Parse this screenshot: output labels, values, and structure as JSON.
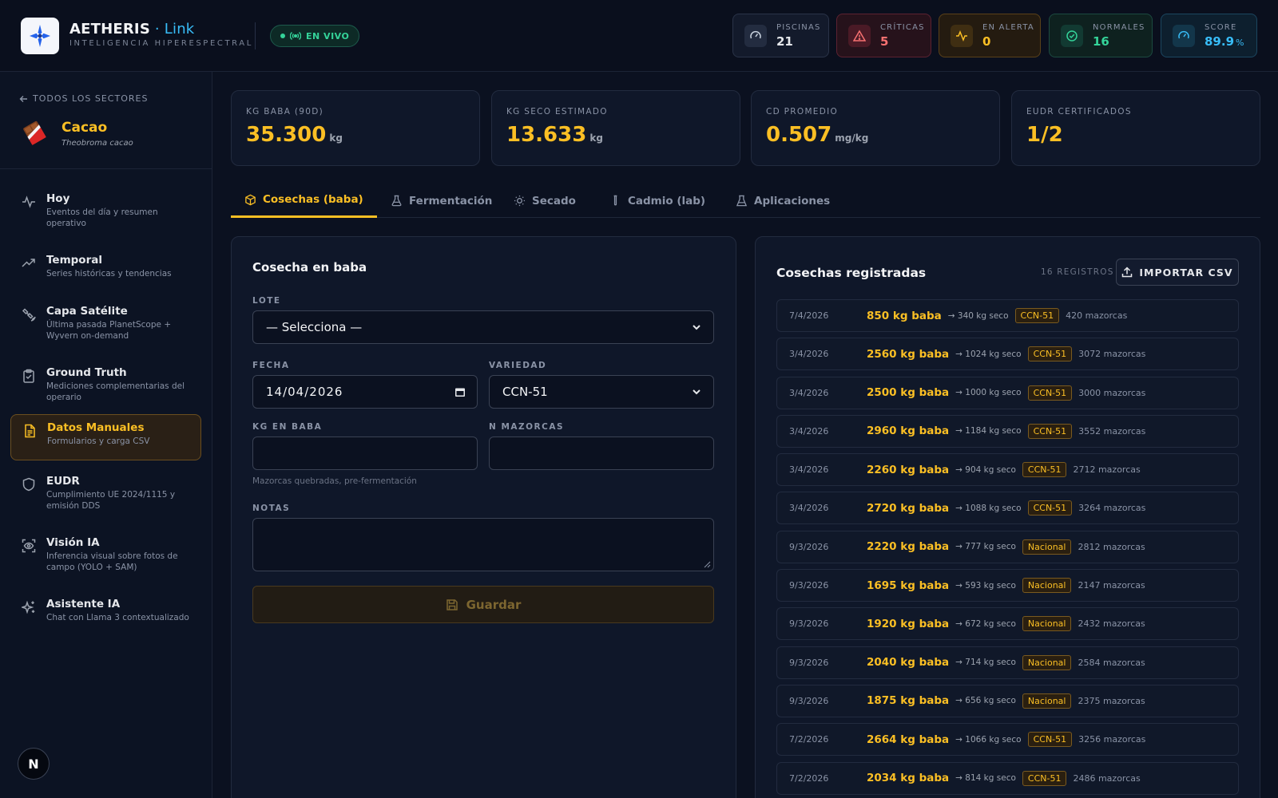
{
  "header": {
    "brand": "AETHERIS",
    "brand_sep": " · ",
    "brand_accent": "Link",
    "subtitle": "INTELIGENCIA HIPERESPECTRAL",
    "live_label": "EN VIVO",
    "stats": [
      {
        "label": "PISCINAS",
        "value": "21",
        "icon": "gauge-icon",
        "color": "#e5e7eb"
      },
      {
        "label": "CRÍTICAS",
        "value": "5",
        "icon": "alert-triangle-icon",
        "color": "#f87171"
      },
      {
        "label": "EN ALERTA",
        "value": "0",
        "icon": "activity-icon",
        "color": "#fbbf24"
      },
      {
        "label": "NORMALES",
        "value": "16",
        "icon": "check-circle-icon",
        "color": "#34d399"
      },
      {
        "label": "SCORE",
        "value": "89.9",
        "unit": "%",
        "icon": "gauge-icon",
        "color": "#38bdf8"
      }
    ]
  },
  "sidebar": {
    "back_label": "TODOS LOS SECTORES",
    "sector_name": "Cacao",
    "sector_scientific": "Theobroma cacao",
    "items": [
      {
        "title": "Hoy",
        "desc": "Eventos del día y resumen operativo",
        "icon": "activity-icon"
      },
      {
        "title": "Temporal",
        "desc": "Series históricas y tendencias",
        "icon": "trending-up-icon"
      },
      {
        "title": "Capa Satélite",
        "desc": "Última pasada PlanetScope + Wyvern on-demand",
        "icon": "satellite-icon"
      },
      {
        "title": "Ground Truth",
        "desc": "Mediciones complementarias del operario",
        "icon": "clipboard-icon"
      },
      {
        "title": "Datos Manuales",
        "desc": "Formularios y carga CSV",
        "icon": "file-text-icon"
      },
      {
        "title": "EUDR",
        "desc": "Cumplimiento UE 2024/1115 y emisión DDS",
        "icon": "shield-icon"
      },
      {
        "title": "Visión IA",
        "desc": "Inferencia visual sobre fotos de campo (YOLO + SAM)",
        "icon": "scan-eye-icon"
      },
      {
        "title": "Asistente IA",
        "desc": "Chat con Llama 3 contextualizado",
        "icon": "sparkles-icon"
      }
    ],
    "footer_badge": "N"
  },
  "kpis": [
    {
      "label": "KG BABA (90D)",
      "value": "35.300",
      "unit": "kg"
    },
    {
      "label": "KG SECO ESTIMADO",
      "value": "13.633",
      "unit": "kg"
    },
    {
      "label": "CD PROMEDIO",
      "value": "0.507",
      "unit": "mg/kg"
    },
    {
      "label": "EUDR CERTIFICADOS",
      "value": "1/2",
      "unit": ""
    }
  ],
  "tabs": [
    {
      "label": "Cosechas (baba)",
      "icon": "box-icon"
    },
    {
      "label": "Fermentación",
      "icon": "flask-icon"
    },
    {
      "label": "Secado",
      "icon": "sun-icon"
    },
    {
      "label": "Cadmio (lab)",
      "icon": "test-tube-icon"
    },
    {
      "label": "Aplicaciones",
      "icon": "beaker-icon"
    }
  ],
  "form": {
    "title": "Cosecha en baba",
    "lote_label": "LOTE",
    "lote_value": "— Selecciona —",
    "fecha_label": "FECHA",
    "fecha_value": "14/04/2026",
    "variedad_label": "VARIEDAD",
    "variedad_value": "CCN-51",
    "kg_label": "KG EN BABA",
    "kg_value": "",
    "mazorcas_label": "N MAZORCAS",
    "mazorcas_value": "",
    "hint": "Mazorcas quebradas, pre-fermentación",
    "notas_label": "NOTAS",
    "notas_value": "",
    "save_label": "Guardar"
  },
  "records": {
    "title": "Cosechas registradas",
    "count_label": "16 REGISTROS",
    "import_label": "IMPORTAR CSV",
    "rows": [
      {
        "date": "7/4/2026",
        "baba": "850 kg baba",
        "seco": "→ 340 kg seco",
        "variety": "CCN-51",
        "mazorcas": "420 mazorcas"
      },
      {
        "date": "3/4/2026",
        "baba": "2560 kg baba",
        "seco": "→ 1024 kg seco",
        "variety": "CCN-51",
        "mazorcas": "3072 mazorcas"
      },
      {
        "date": "3/4/2026",
        "baba": "2500 kg baba",
        "seco": "→ 1000 kg seco",
        "variety": "CCN-51",
        "mazorcas": "3000 mazorcas"
      },
      {
        "date": "3/4/2026",
        "baba": "2960 kg baba",
        "seco": "→ 1184 kg seco",
        "variety": "CCN-51",
        "mazorcas": "3552 mazorcas"
      },
      {
        "date": "3/4/2026",
        "baba": "2260 kg baba",
        "seco": "→ 904 kg seco",
        "variety": "CCN-51",
        "mazorcas": "2712 mazorcas"
      },
      {
        "date": "3/4/2026",
        "baba": "2720 kg baba",
        "seco": "→ 1088 kg seco",
        "variety": "CCN-51",
        "mazorcas": "3264 mazorcas"
      },
      {
        "date": "9/3/2026",
        "baba": "2220 kg baba",
        "seco": "→ 777 kg seco",
        "variety": "Nacional",
        "mazorcas": "2812 mazorcas"
      },
      {
        "date": "9/3/2026",
        "baba": "1695 kg baba",
        "seco": "→ 593 kg seco",
        "variety": "Nacional",
        "mazorcas": "2147 mazorcas"
      },
      {
        "date": "9/3/2026",
        "baba": "1920 kg baba",
        "seco": "→ 672 kg seco",
        "variety": "Nacional",
        "mazorcas": "2432 mazorcas"
      },
      {
        "date": "9/3/2026",
        "baba": "2040 kg baba",
        "seco": "→ 714 kg seco",
        "variety": "Nacional",
        "mazorcas": "2584 mazorcas"
      },
      {
        "date": "9/3/2026",
        "baba": "1875 kg baba",
        "seco": "→ 656 kg seco",
        "variety": "Nacional",
        "mazorcas": "2375 mazorcas"
      },
      {
        "date": "7/2/2026",
        "baba": "2664 kg baba",
        "seco": "→ 1066 kg seco",
        "variety": "CCN-51",
        "mazorcas": "3256 mazorcas"
      },
      {
        "date": "7/2/2026",
        "baba": "2034 kg baba",
        "seco": "→ 814 kg seco",
        "variety": "CCN-51",
        "mazorcas": "2486 mazorcas"
      }
    ]
  },
  "colors": {
    "accent": "#fbbf24",
    "live": "#34d399",
    "brand_accent": "#38bdf8"
  }
}
